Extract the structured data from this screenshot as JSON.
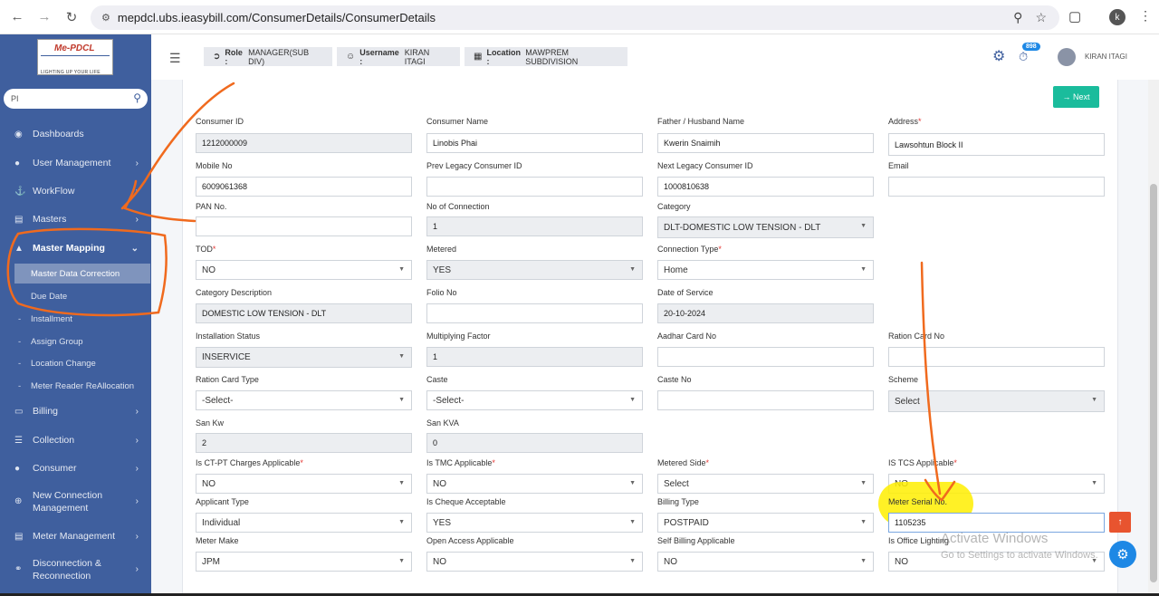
{
  "browser": {
    "url": "mepdcl.ubs.ieasybill.com/ConsumerDetails/ConsumerDetails",
    "profile_initial": "k"
  },
  "logo": {
    "title": "Me-PDCL",
    "subtitle": "LIGHTING UP YOUR LIFE"
  },
  "sidebar": {
    "search_value": "PI",
    "items": {
      "dashboards": "Dashboards",
      "user_management": "User Management",
      "workflow": "WorkFlow",
      "masters": "Masters",
      "master_mapping": "Master Mapping",
      "master_data_correction": "Master Data Correction",
      "due_date": "Due Date",
      "installment": "Installment",
      "assign_group": "Assign Group",
      "location_change": "Location Change",
      "meter_reader_reallocation": "Meter Reader ReAllocation",
      "billing": "Billing",
      "collection": "Collection",
      "consumer": "Consumer",
      "new_connection_1": "New Connection",
      "new_connection_2": "Management",
      "meter_management": "Meter Management",
      "disconnection_1": "Disconnection &",
      "disconnection_2": "Reconnection"
    }
  },
  "header": {
    "role_label": "Role :",
    "role_value": "MANAGER(SUB DIV)",
    "username_label": "Username :",
    "username_value": "KIRAN ITAGI",
    "location_label": "Location :",
    "location_value": "MAWPREM SUBDIVISION",
    "notification_count": "898",
    "user_name": "KIRAN ITAGI"
  },
  "actions": {
    "next": "→ Next"
  },
  "form": {
    "consumer_id": {
      "label": "Consumer ID",
      "value": "1212000009"
    },
    "consumer_name": {
      "label": "Consumer Name",
      "value": "Linobis Phai"
    },
    "father_name": {
      "label": "Father / Husband Name",
      "value": "Kwerin Snaimih"
    },
    "address": {
      "label": "Address",
      "value": "Lawsohtun Block II"
    },
    "mobile_no": {
      "label": "Mobile No",
      "value": "6009061368"
    },
    "prev_legacy_id": {
      "label": "Prev Legacy Consumer ID",
      "value": ""
    },
    "next_legacy_id": {
      "label": "Next Legacy Consumer ID",
      "value": "1000810638"
    },
    "email": {
      "label": "Email",
      "value": ""
    },
    "pan_no": {
      "label": "PAN No.",
      "value": ""
    },
    "no_of_connection": {
      "label": "No of Connection",
      "value": "1"
    },
    "category": {
      "label": "Category",
      "value": "DLT-DOMESTIC LOW TENSION - DLT"
    },
    "tod": {
      "label": "TOD",
      "value": "NO"
    },
    "metered": {
      "label": "Metered",
      "value": "YES"
    },
    "connection_type": {
      "label": "Connection Type",
      "value": "Home"
    },
    "category_description": {
      "label": "Category Description",
      "value": "DOMESTIC LOW TENSION - DLT"
    },
    "folio_no": {
      "label": "Folio No",
      "value": ""
    },
    "date_of_service": {
      "label": "Date of Service",
      "value": "20-10-2024"
    },
    "installation_status": {
      "label": "Installation Status",
      "value": "INSERVICE"
    },
    "multiplying_factor": {
      "label": "Multiplying Factor",
      "value": "1"
    },
    "aadhar_card_no": {
      "label": "Aadhar Card No",
      "value": ""
    },
    "ration_card_no": {
      "label": "Ration Card No",
      "value": ""
    },
    "ration_card_type": {
      "label": "Ration Card Type",
      "value": "-Select-"
    },
    "caste": {
      "label": "Caste",
      "value": "-Select-"
    },
    "caste_no": {
      "label": "Caste No",
      "value": ""
    },
    "scheme": {
      "label": "Scheme",
      "value": "Select"
    },
    "san_kw": {
      "label": "San Kw",
      "value": "2"
    },
    "san_kva": {
      "label": "San KVA",
      "value": "0"
    },
    "ct_pt_charges": {
      "label": "Is CT-PT Charges Applicable",
      "value": "NO"
    },
    "tmc_applicable": {
      "label": "Is TMC Applicable",
      "value": "NO"
    },
    "metered_side": {
      "label": "Metered Side",
      "value": "Select"
    },
    "tcs_applicable": {
      "label": "IS TCS Applicable",
      "value": "NO"
    },
    "applicant_type": {
      "label": "Applicant Type",
      "value": "Individual"
    },
    "cheque_acceptable": {
      "label": "Is Cheque Acceptable",
      "value": "YES"
    },
    "billing_type": {
      "label": "Billing Type",
      "value": "POSTPAID"
    },
    "meter_serial_no": {
      "label": "Meter Serial No.",
      "value": "1105235"
    },
    "meter_make": {
      "label": "Meter Make",
      "value": "JPM"
    },
    "open_access": {
      "label": "Open Access Applicable",
      "value": "NO"
    },
    "self_billing": {
      "label": "Self Billing Applicable",
      "value": "NO"
    },
    "office_lighting": {
      "label": "Is Office Lighting",
      "value": "NO"
    }
  },
  "watermark": {
    "line1": "Activate Windows",
    "line2": "Go to Settings to activate Windows."
  },
  "colors": {
    "sidebar": "#3f5f9e",
    "accent": "#1abc9c",
    "annotation": "#f06a1e",
    "highlight": "#ffee00"
  }
}
